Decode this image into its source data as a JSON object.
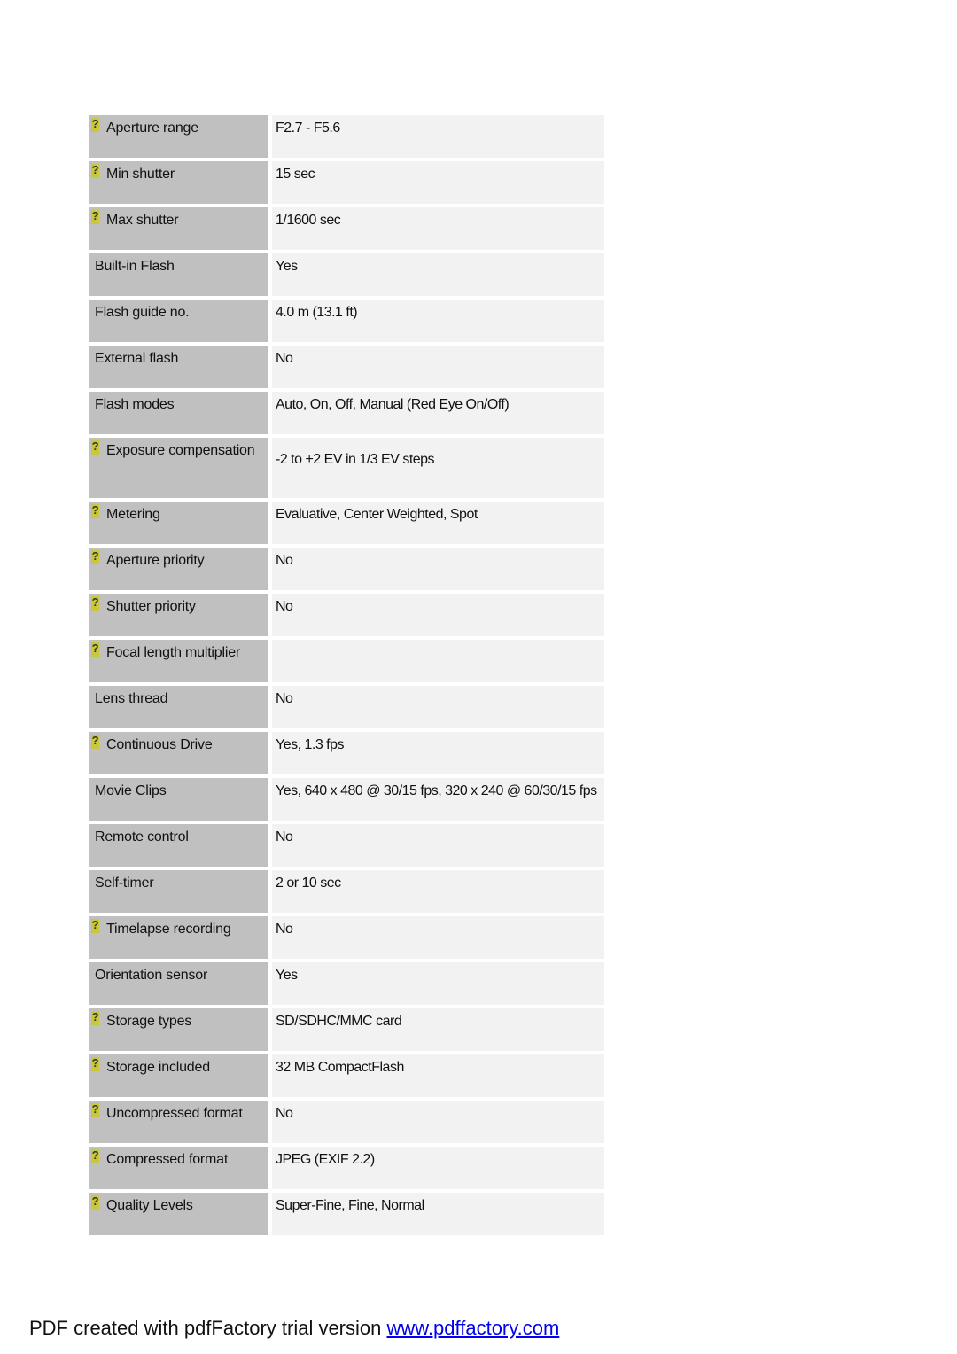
{
  "specs": [
    {
      "label": "Aperture range",
      "value": "F2.7 - F5.6",
      "help": true
    },
    {
      "label": "Min shutter",
      "value": "15 sec",
      "help": true
    },
    {
      "label": "Max shutter",
      "value": "1/1600 sec",
      "help": true
    },
    {
      "label": "Built-in Flash",
      "value": "Yes",
      "help": false
    },
    {
      "label": "Flash guide no.",
      "value": "4.0 m (13.1 ft)",
      "help": false
    },
    {
      "label": "External flash",
      "value": "No",
      "help": false
    },
    {
      "label": "Flash modes",
      "value": "Auto, On, Off, Manual (Red Eye On/Off)",
      "help": false
    },
    {
      "label": "Exposure compensation",
      "value": "-2 to +2 EV in 1/3 EV steps",
      "help": true
    },
    {
      "label": "Metering",
      "value": "Evaluative, Center Weighted, Spot",
      "help": true
    },
    {
      "label": "Aperture priority",
      "value": "No",
      "help": true
    },
    {
      "label": "Shutter priority",
      "value": "No",
      "help": true
    },
    {
      "label": "Focal length multiplier",
      "value": "",
      "help": true
    },
    {
      "label": "Lens thread",
      "value": "No",
      "help": false
    },
    {
      "label": "Continuous Drive",
      "value": "Yes, 1.3 fps",
      "help": true
    },
    {
      "label": "Movie Clips",
      "value": "Yes, 640 x 480 @ 30/15 fps, 320 x 240 @ 60/30/15 fps",
      "help": false
    },
    {
      "label": "Remote control",
      "value": "No",
      "help": false
    },
    {
      "label": "Self-timer",
      "value": "2 or 10 sec",
      "help": false
    },
    {
      "label": "Timelapse recording",
      "value": "No",
      "help": true
    },
    {
      "label": "Orientation sensor",
      "value": "Yes",
      "help": false
    },
    {
      "label": "Storage types",
      "value": "SD/SDHC/MMC card",
      "help": true
    },
    {
      "label": "Storage included",
      "value": "32 MB CompactFlash",
      "help": true
    },
    {
      "label": "Uncompressed format",
      "value": "No",
      "help": true
    },
    {
      "label": "Compressed format",
      "value": "JPEG (EXIF 2.2)",
      "help": true
    },
    {
      "label": "Quality Levels",
      "value": "Super-Fine, Fine, Normal",
      "help": true
    }
  ],
  "help_icon_glyph": "?",
  "footer": {
    "text": "PDF created with pdfFactory trial version ",
    "link_text": "www.pdffactory.com"
  }
}
